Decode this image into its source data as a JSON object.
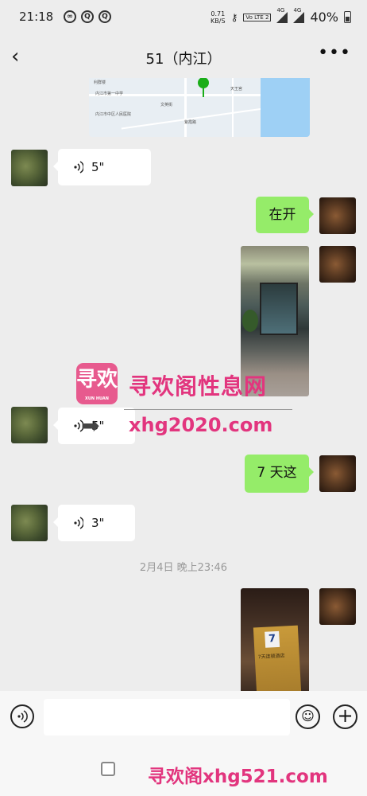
{
  "status_bar": {
    "time": "21:18",
    "net_speed": "0.71",
    "net_speed_unit": "KB/S",
    "volte_label": "Vo LTE 2",
    "signal_1": "4G",
    "signal_2": "4G",
    "battery": "40%"
  },
  "chat": {
    "title": "51（内江）"
  },
  "messages": [
    {
      "kind": "voice",
      "side": "in",
      "duration": "5\""
    },
    {
      "kind": "text",
      "side": "out",
      "text": "在开"
    },
    {
      "kind": "voice",
      "side": "in",
      "duration": "5\""
    },
    {
      "kind": "text",
      "side": "out",
      "text": "7 天这"
    },
    {
      "kind": "voice",
      "side": "in",
      "duration": "3\""
    }
  ],
  "timestamp": "2月4日 晚上23:46",
  "watermark": {
    "logo_text": "寻欢",
    "logo_small": "XUN HUAN",
    "title": "寻欢阁性息网",
    "url": "xhg2020.com",
    "footer": "寻欢阁xhg521.com"
  },
  "photo2_sign": "7天连锁酒店",
  "map_labels": [
    "利群楼",
    "天王宫",
    "内江市第一中学",
    "内江市中区人民医院",
    "文英街",
    "紫霞路"
  ],
  "colors": {
    "background": "#ededed",
    "out_bubble": "#95ec69",
    "in_bubble": "#ffffff",
    "watermark": "#e2357e"
  }
}
